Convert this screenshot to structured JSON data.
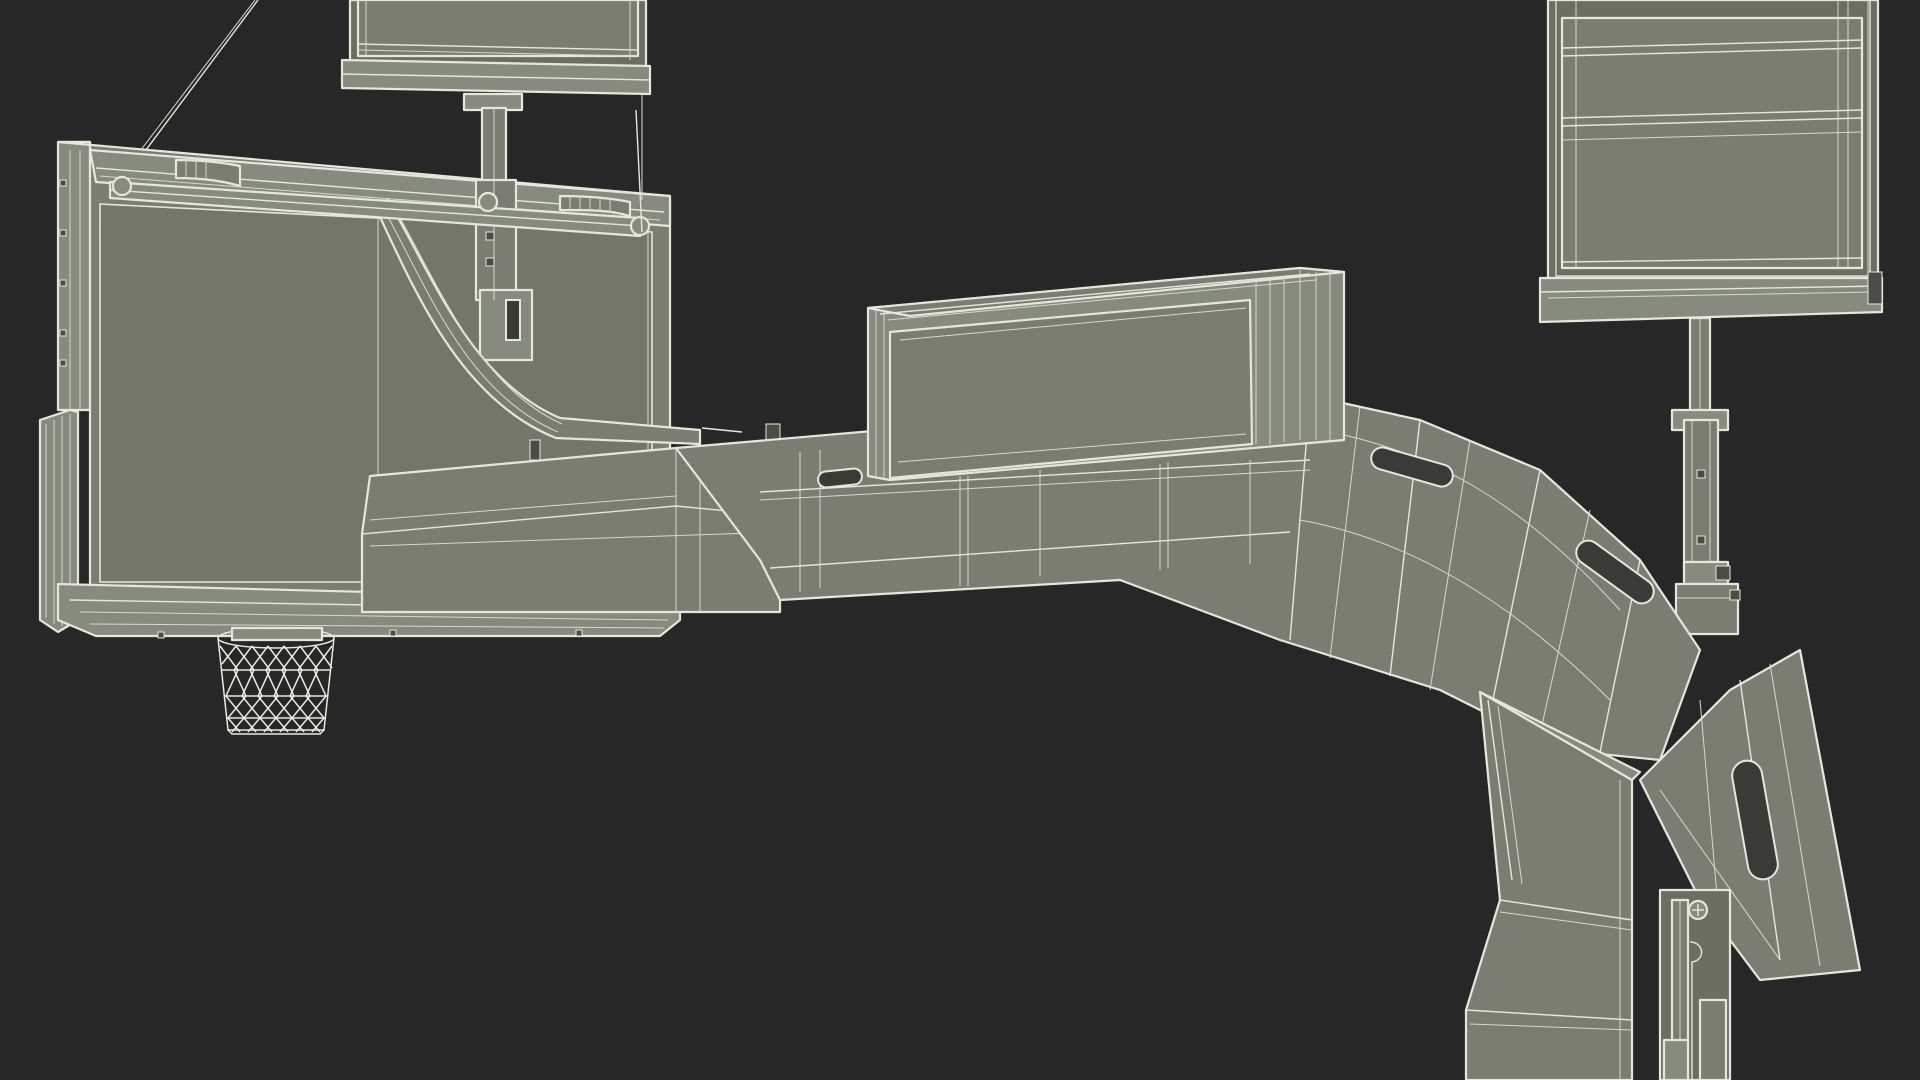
{
  "scene": {
    "subject": "basketball-hoop-wireframe-render",
    "background_color": "#272727",
    "material_color": "#7b7d72",
    "wire_color": "#e6e6dc"
  }
}
